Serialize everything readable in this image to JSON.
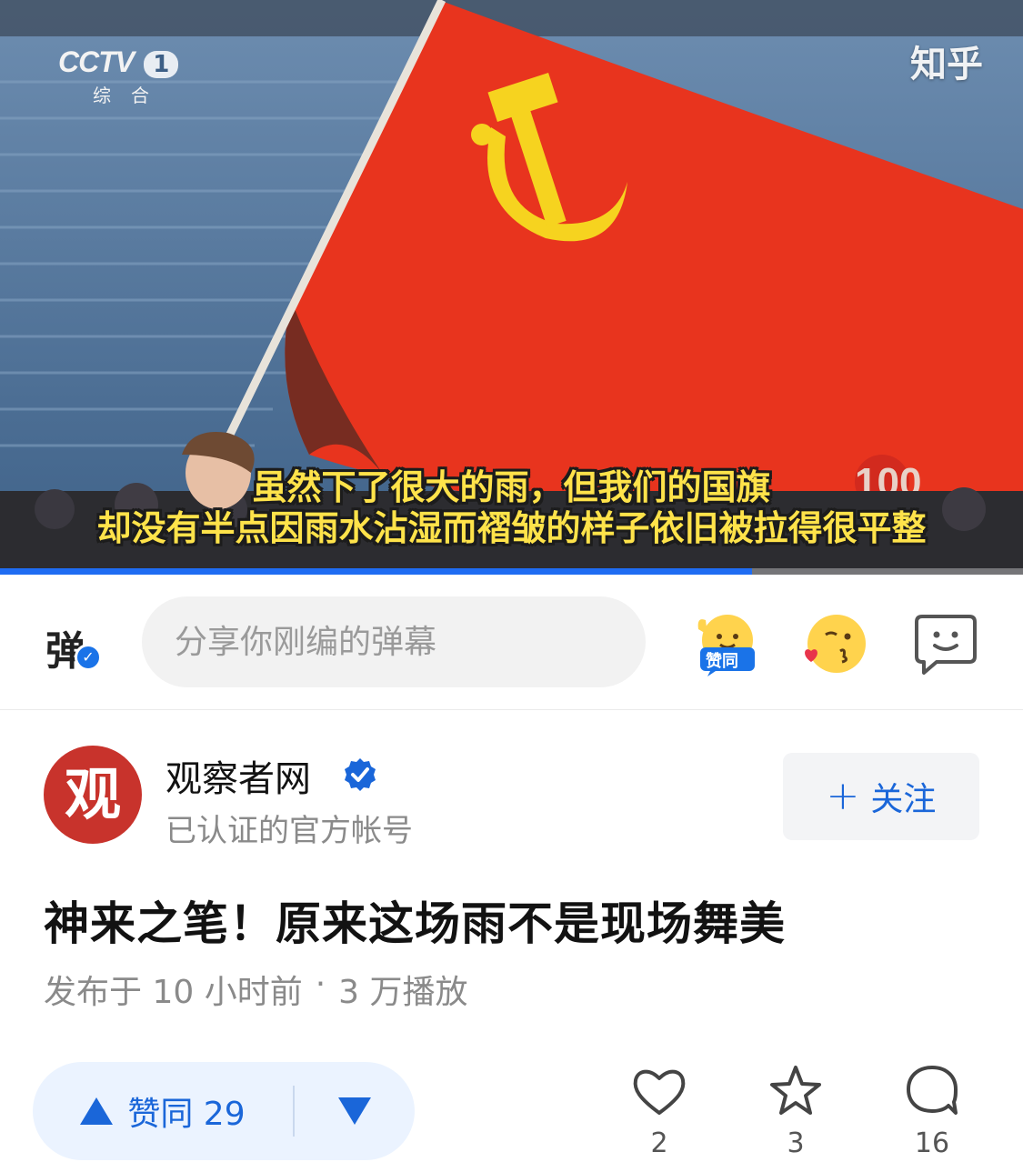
{
  "video": {
    "channel_logo": "CCTV",
    "channel_number": "1",
    "channel_sub": "综合",
    "watermark": "知乎",
    "subtitle_line1": "虽然下了很大的雨，但我们的国旗",
    "subtitle_line2": "却没有半点因雨水沾湿而褶皱的样子依旧被拉得很平整",
    "progress_fraction": 0.735
  },
  "danmaku": {
    "toggle_glyph": "弹",
    "input_placeholder": "分享你刚编的弹幕",
    "emoji_agree_label": "赞同",
    "emoji_agree_icon": "agree-emoji-icon",
    "emoji_kiss_icon": "kiss-emoji-icon",
    "emoji_face_icon": "smiley-bubble-icon"
  },
  "author": {
    "avatar_text": "观",
    "name": "观察者网",
    "description": "已认证的官方帐号",
    "follow_label": "关注",
    "follow_icon": "plus-icon"
  },
  "post": {
    "title": "神来之笔！原来这场雨不是现场舞美",
    "published": "发布于 10 小时前",
    "separator": "·",
    "plays": "3 万播放"
  },
  "actions": {
    "agree_label": "赞同 29",
    "like_count": "2",
    "favorite_count": "3",
    "comment_count": "16"
  },
  "colors": {
    "accent": "#1a66d9",
    "flag_red": "#e8341e",
    "emblem_yellow": "#f6d31f",
    "subtitle_yellow": "#ffe34a"
  }
}
